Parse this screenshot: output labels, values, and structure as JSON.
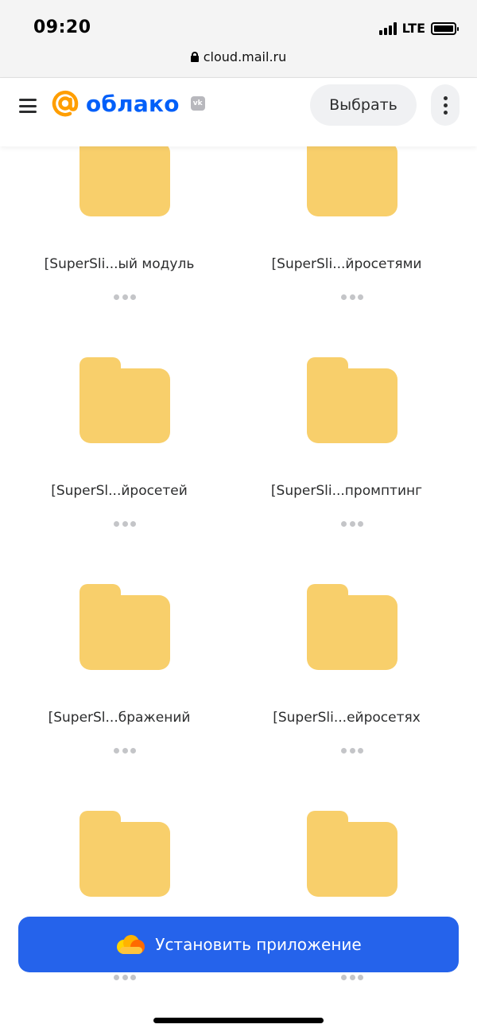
{
  "status_bar": {
    "time": "09:20",
    "network": "LTE"
  },
  "browser": {
    "url": "cloud.mail.ru"
  },
  "header": {
    "logo_text": "облако",
    "vk_badge": "vk",
    "select_label": "Выбрать"
  },
  "folders": [
    {
      "name": "[SuperSli...ый модуль"
    },
    {
      "name": "[SuperSli...йросетями"
    },
    {
      "name": "[SuperSl...йросетей"
    },
    {
      "name": "[SuperSli...промптинг"
    },
    {
      "name": "[SuperSl...бражений"
    },
    {
      "name": "[SuperSli...ейросетях"
    },
    {
      "name": ""
    },
    {
      "name": ""
    }
  ],
  "install_banner": {
    "label": "Установить приложение"
  },
  "colors": {
    "brand_blue": "#005ff9",
    "banner_blue": "#2563eb",
    "folder_yellow": "#f8cf6b",
    "logo_orange": "#ff9e00"
  }
}
